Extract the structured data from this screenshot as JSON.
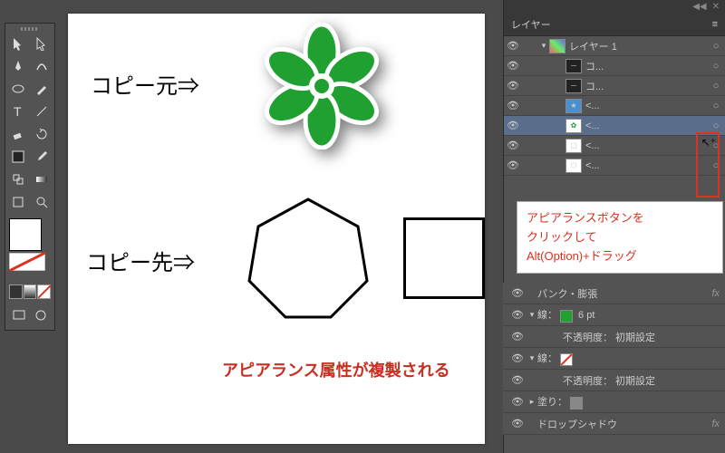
{
  "canvas": {
    "copy_source_label": "コピー元⇒",
    "copy_dest_label": "コピー先⇒",
    "note": "アピアランス属性が複製される"
  },
  "callout": {
    "line1": "アピアランスボタンを",
    "line2": "クリックして",
    "line3": "Alt(Option)+ドラッグ"
  },
  "layers_panel": {
    "title": "レイヤー",
    "rows": [
      {
        "name": "レイヤー 1",
        "thumb": "layer",
        "indent": 0,
        "disclose": "▾",
        "sel": false
      },
      {
        "name": "コ...",
        "thumb": "txt",
        "indent": 1,
        "sel": false
      },
      {
        "name": "コ...",
        "thumb": "txt",
        "indent": 1,
        "sel": false
      },
      {
        "name": "<...",
        "thumb": "star",
        "indent": 1,
        "sel": false
      },
      {
        "name": "<...",
        "thumb": "flower",
        "indent": 1,
        "sel": true
      },
      {
        "name": "<...",
        "thumb": "rect",
        "indent": 1,
        "sel": false
      },
      {
        "name": "<...",
        "thumb": "poly",
        "indent": 1,
        "sel": false
      }
    ]
  },
  "appearance_panel": {
    "rows": [
      {
        "label": "パンク・膨張",
        "fx": true
      },
      {
        "label": "線：",
        "swatch": "#1fa030",
        "value": "6 pt",
        "disclose": "▾"
      },
      {
        "label": "不透明度：",
        "value": "初期設定",
        "sub": true
      },
      {
        "label": "線：",
        "swatch": "none",
        "disclose": "▾"
      },
      {
        "label": "不透明度：",
        "value": "初期設定",
        "sub": true
      },
      {
        "label": "塗り：",
        "swatch": "#888",
        "disclose": "▸"
      },
      {
        "label": "ドロップシャドウ",
        "fx": true
      }
    ]
  },
  "tools": [
    "select",
    "direct",
    "pen",
    "curve",
    "brush",
    "blob",
    "ellipse",
    "paint",
    "type",
    "line",
    "eraser",
    "rotate",
    "scale",
    "width",
    "shape",
    "free",
    "eyedrop",
    "gradient",
    "mesh",
    "perspective",
    "artboard",
    "slice",
    "pan",
    "zoom"
  ]
}
